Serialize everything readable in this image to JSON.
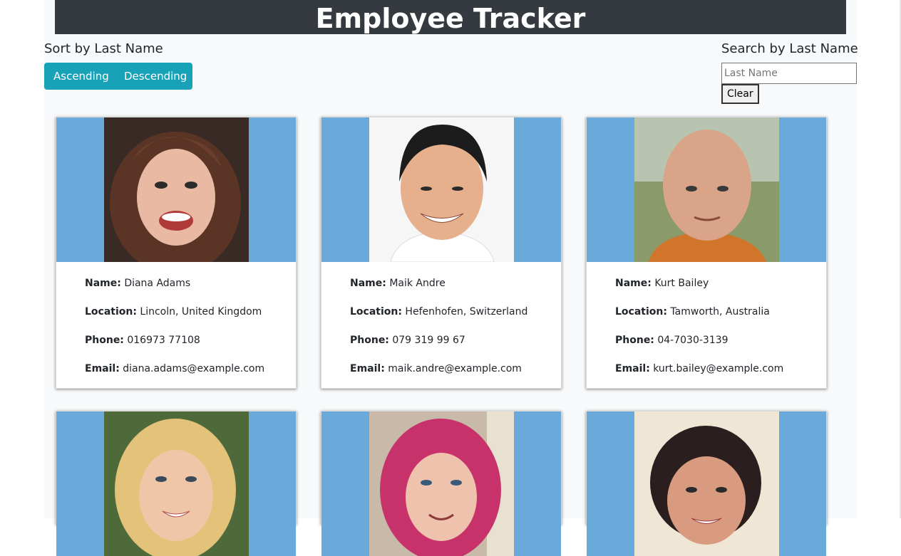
{
  "app": {
    "title": "Employee Tracker"
  },
  "sort": {
    "title": "Sort by Last Name",
    "ascending_label": "Ascending",
    "descending_label": "Descending"
  },
  "search": {
    "title": "Search by Last Name",
    "placeholder": "Last Name",
    "value": "",
    "clear_label": "Clear"
  },
  "labels": {
    "name": "Name:",
    "location": "Location:",
    "phone": "Phone:",
    "email": "Email:"
  },
  "colors": {
    "header_bg": "#343a40",
    "button_accent": "#17a2b8",
    "photo_bg": "#6aaadb"
  },
  "employees": [
    {
      "name": "Diana Adams",
      "location": "Lincoln, United Kingdom",
      "phone": "016973 77108",
      "email": "diana.adams@example.com",
      "photo": "avatar-woman-brown-hair"
    },
    {
      "name": "Maik Andre",
      "location": "Hefenhofen, Switzerland",
      "phone": "079 319 99 67",
      "email": "maik.andre@example.com",
      "photo": "avatar-man-black-hair"
    },
    {
      "name": "Kurt Bailey",
      "location": "Tamworth, Australia",
      "phone": "04-7030-3139",
      "email": "kurt.bailey@example.com",
      "photo": "avatar-man-bald"
    },
    {
      "photo": "avatar-woman-blonde"
    },
    {
      "photo": "avatar-woman-pink-hair"
    },
    {
      "photo": "avatar-woman-dark-hair"
    }
  ]
}
